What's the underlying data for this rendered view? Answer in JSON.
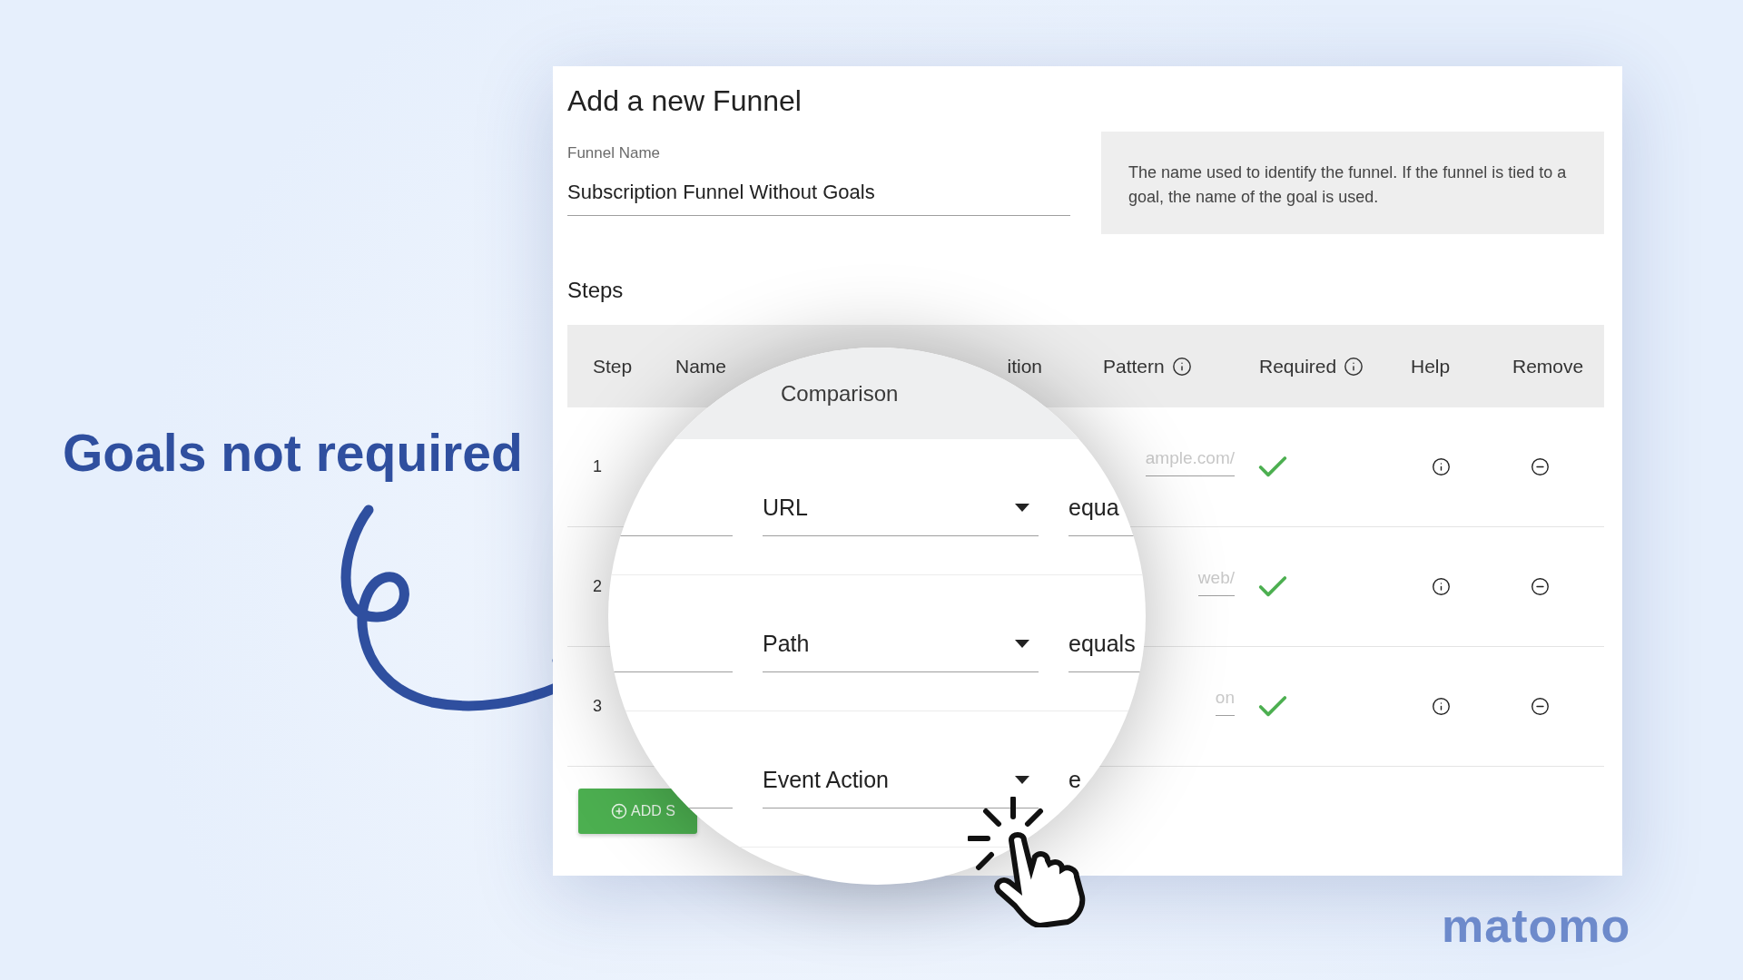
{
  "headline": "Goals not required",
  "dialog": {
    "title": "Add a new Funnel",
    "funnel_name": {
      "label": "Funnel Name",
      "value": "Subscription Funnel Without Goals"
    },
    "help_text": "The name used to identify the funnel. If the funnel is tied to a goal, the name of the goal is used.",
    "steps_title": "Steps",
    "table": {
      "columns": [
        {
          "label": "Step",
          "info": false
        },
        {
          "label": "Name",
          "info": false
        },
        {
          "label": "ition",
          "info": false
        },
        {
          "label": "Pattern",
          "info": true
        },
        {
          "label": "Required",
          "info": true
        },
        {
          "label": "Help",
          "info": false
        },
        {
          "label": "Remove",
          "info": false
        }
      ],
      "rows": [
        {
          "step": "1",
          "pattern": "ample.com/",
          "required": true
        },
        {
          "step": "2",
          "pattern": "web/",
          "required": true
        },
        {
          "step": "3",
          "pattern": "on",
          "required": true
        }
      ]
    },
    "add_button": "ADD S"
  },
  "magnifier": {
    "header": "Comparison",
    "rows": [
      {
        "comparison": "URL",
        "condition": "equa"
      },
      {
        "comparison": "Path",
        "condition": "equals"
      },
      {
        "comparison": "Event Action",
        "condition": "e"
      }
    ]
  },
  "logo": "matomo"
}
